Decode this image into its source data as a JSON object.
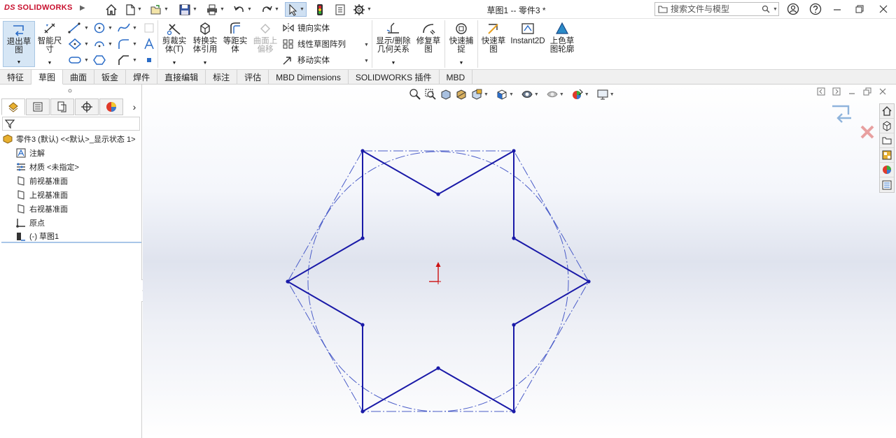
{
  "app": {
    "logo_ds": "DS",
    "logo_text": "SOLIDWORKS",
    "document_title": "草图1 -- 零件3 *"
  },
  "search": {
    "placeholder": "搜索文件与模型"
  },
  "ribbon": {
    "exit_sketch": "退出草\n图",
    "smart_dimension": "智能尺\n寸",
    "trim_entities": "剪裁实\n体(T)",
    "convert_entities": "转换实\n体引用",
    "offset_entities": "等距实\n体",
    "offset_on_surface": "曲面上\n偏移",
    "mirror_entities": "镜向实体",
    "linear_pattern": "线性草图阵列",
    "move_entities": "移动实体",
    "display_delete_relations": "显示/删除\n几何关系",
    "repair_sketch": "修复草\n图",
    "quick_snaps": "快速捕\n捉",
    "rapid_sketch": "快速草\n图",
    "instant2d": "Instant2D",
    "shaded_sketch": "上色草\n图轮廓"
  },
  "tabs": [
    {
      "label": "特征",
      "active": false
    },
    {
      "label": "草图",
      "active": true
    },
    {
      "label": "曲面",
      "active": false
    },
    {
      "label": "钣金",
      "active": false
    },
    {
      "label": "焊件",
      "active": false
    },
    {
      "label": "直接编辑",
      "active": false
    },
    {
      "label": "标注",
      "active": false
    },
    {
      "label": "评估",
      "active": false
    },
    {
      "label": "MBD Dimensions",
      "active": false
    },
    {
      "label": "SOLIDWORKS 插件",
      "active": false
    },
    {
      "label": "MBD",
      "active": false
    }
  ],
  "tree": {
    "root": "零件3 (默认) <<默认>_显示状态 1>",
    "items": [
      "注解",
      "材质 <未指定>",
      "前视基准面",
      "上视基准面",
      "右视基准面",
      "原点",
      "(-) 草图1"
    ]
  },
  "colors": {
    "sketch_line": "#1a1aa8",
    "construction_line": "#4a5cc8",
    "origin": "#cc1111",
    "accent": "#c8102e"
  }
}
